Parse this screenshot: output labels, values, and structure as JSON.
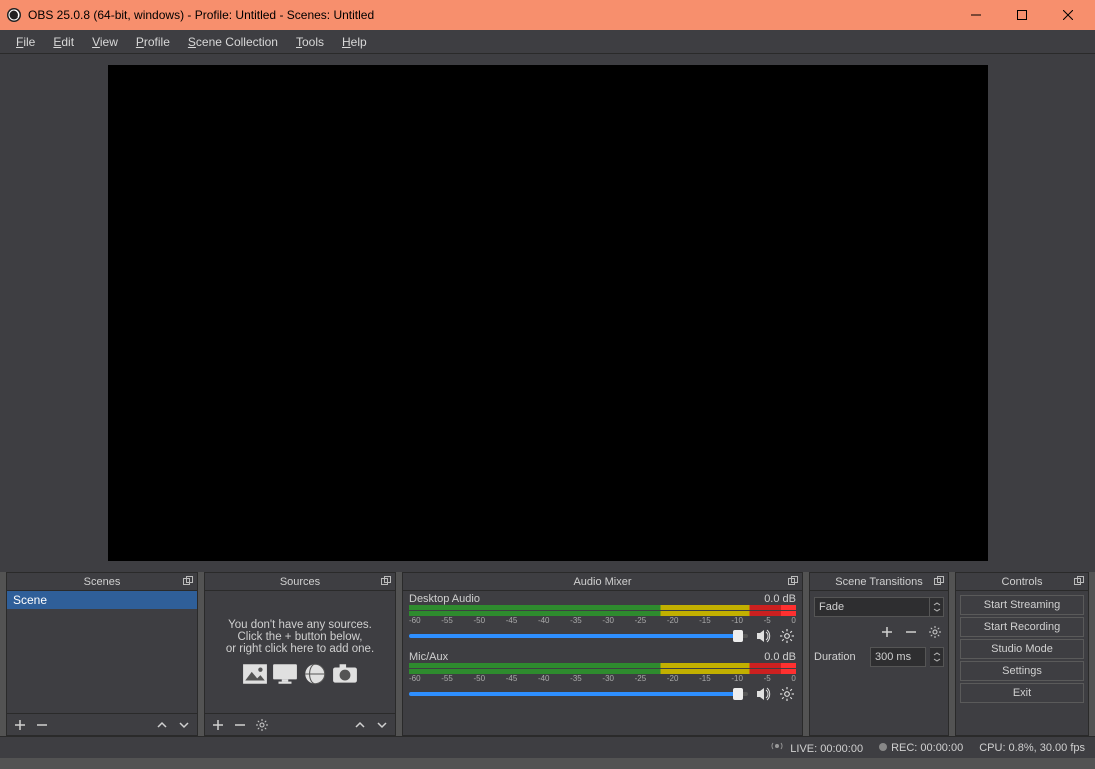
{
  "titlebar": {
    "text": "OBS 25.0.8 (64-bit, windows) - Profile: Untitled - Scenes: Untitled"
  },
  "menu": {
    "items": [
      {
        "label": "File",
        "hotkey": "F"
      },
      {
        "label": "Edit",
        "hotkey": "E"
      },
      {
        "label": "View",
        "hotkey": "V"
      },
      {
        "label": "Profile",
        "hotkey": "P"
      },
      {
        "label": "Scene Collection",
        "hotkey": "S"
      },
      {
        "label": "Tools",
        "hotkey": "T"
      },
      {
        "label": "Help",
        "hotkey": "H"
      }
    ]
  },
  "scenes": {
    "title": "Scenes",
    "items": [
      {
        "name": "Scene"
      }
    ]
  },
  "sources": {
    "title": "Sources",
    "empty_line1": "You don't have any sources.",
    "empty_line2": "Click the + button below,",
    "empty_line3": "or right click here to add one."
  },
  "mixer": {
    "title": "Audio Mixer",
    "scale": [
      "-60",
      "-55",
      "-50",
      "-45",
      "-40",
      "-35",
      "-30",
      "-25",
      "-20",
      "-15",
      "-10",
      "-5",
      "0"
    ],
    "channels": [
      {
        "name": "Desktop Audio",
        "db": "0.0 dB"
      },
      {
        "name": "Mic/Aux",
        "db": "0.0 dB"
      }
    ]
  },
  "transitions": {
    "title": "Scene Transitions",
    "selected": "Fade",
    "duration_label": "Duration",
    "duration_value": "300 ms"
  },
  "controls": {
    "title": "Controls",
    "buttons": [
      "Start Streaming",
      "Start Recording",
      "Studio Mode",
      "Settings",
      "Exit"
    ]
  },
  "status": {
    "live": "LIVE: 00:00:00",
    "rec": "REC: 00:00:00",
    "cpu": "CPU: 0.8%, 30.00 fps"
  }
}
